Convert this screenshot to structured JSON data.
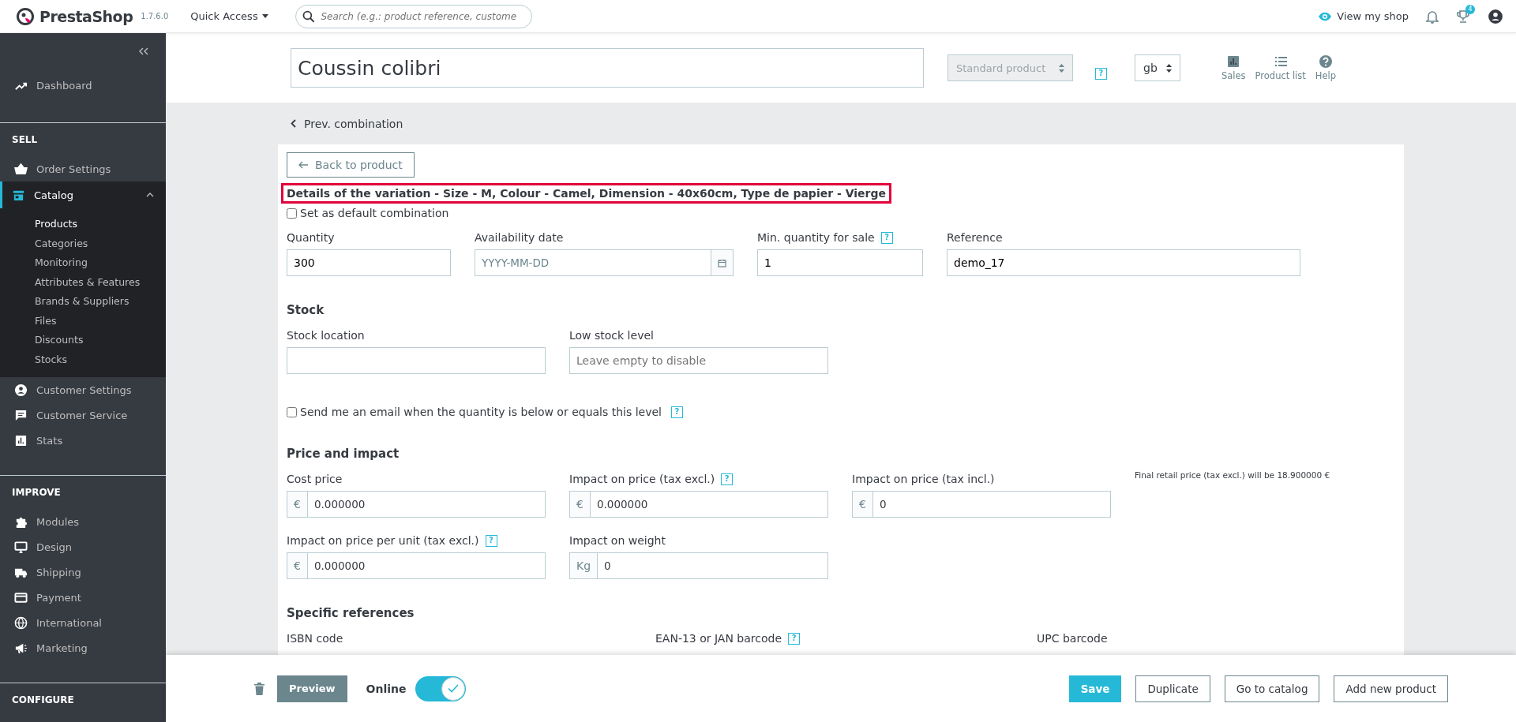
{
  "topbar": {
    "logo": "PrestaShop",
    "version": "1.7.6.0",
    "quick_access": "Quick Access",
    "search": {
      "placeholder": "Search (e.g.: product reference, custome"
    },
    "view_shop": "View my shop",
    "notifications_badge": "4"
  },
  "sidebar": {
    "groups": [
      {
        "items": [
          {
            "label": "Dashboard",
            "kind": "trend",
            "selected": false
          }
        ]
      },
      {
        "heading": "SELL",
        "items": [
          {
            "label": "Order Settings",
            "kind": "basket",
            "selected": false
          },
          {
            "label": "Catalog",
            "kind": "store",
            "selected": true,
            "expanded": true,
            "children": [
              {
                "label": "Products",
                "selected": true
              },
              {
                "label": "Categories",
                "selected": false
              },
              {
                "label": "Monitoring",
                "selected": false
              },
              {
                "label": "Attributes & Features",
                "selected": false
              },
              {
                "label": "Brands & Suppliers",
                "selected": false
              },
              {
                "label": "Files",
                "selected": false
              },
              {
                "label": "Discounts",
                "selected": false
              },
              {
                "label": "Stocks",
                "selected": false
              }
            ]
          },
          {
            "label": "Customer Settings",
            "kind": "person",
            "selected": false
          },
          {
            "label": "Customer Service",
            "kind": "chat",
            "selected": false
          },
          {
            "label": "Stats",
            "kind": "chart",
            "selected": false
          }
        ]
      },
      {
        "heading": "IMPROVE",
        "items": [
          {
            "label": "Modules",
            "kind": "puzzle",
            "selected": false
          },
          {
            "label": "Design",
            "kind": "monitor",
            "selected": false
          },
          {
            "label": "Shipping",
            "kind": "truck",
            "selected": false
          },
          {
            "label": "Payment",
            "kind": "card",
            "selected": false
          },
          {
            "label": "International",
            "kind": "globe",
            "selected": false
          },
          {
            "label": "Marketing",
            "kind": "megaphone",
            "selected": false
          }
        ]
      },
      {
        "heading": "CONFIGURE"
      }
    ]
  },
  "header": {
    "product_name": "Coussin colibri",
    "product_type": {
      "value": "Standard product",
      "disabled": true
    },
    "type_help": "?",
    "language": "gb",
    "actions": [
      {
        "label": "Sales",
        "kind": "chart"
      },
      {
        "label": "Product list",
        "kind": "list"
      },
      {
        "label": "Help",
        "kind": "help"
      }
    ]
  },
  "content": {
    "prev_link": "Prev. combination",
    "back_button": "Back to product",
    "title": {
      "text": "Details of the variation - Size - M, Colour - Camel, Dimension - 40x60cm, Type de papier - Vierge",
      "highlighted": true
    },
    "blocks": [
      {
        "kind": "checkbox",
        "label": "Set as default combination",
        "checked": false
      },
      {
        "kind": "fields",
        "fields": [
          {
            "kind": "text",
            "label": "Quantity",
            "value": "300"
          },
          {
            "kind": "date",
            "label": "Availability date",
            "placeholder": "YYYY-MM-DD"
          },
          {
            "kind": "text",
            "label": "Min. quantity for sale",
            "help": "?",
            "value": "1"
          },
          {
            "kind": "text",
            "label": "Reference",
            "value": "demo_17"
          }
        ]
      },
      {
        "kind": "heading",
        "text": "Stock"
      },
      {
        "kind": "fields",
        "fields": [
          {
            "kind": "text",
            "label": "Stock location"
          },
          {
            "kind": "text",
            "label": "Low stock level",
            "placeholder": "Leave empty to disable"
          }
        ]
      },
      {
        "kind": "checkbox",
        "label": "Send me an email when the quantity is below or equals this level",
        "help": "?",
        "checked": false
      },
      {
        "kind": "heading",
        "text": "Price and impact"
      },
      {
        "kind": "fields",
        "fields": [
          {
            "kind": "prefixed",
            "label": "Cost price",
            "prefix": "€",
            "value": "0.000000"
          },
          {
            "kind": "prefixed",
            "label": "Impact on price (tax excl.)",
            "help": "?",
            "prefix": "€",
            "value": "0.000000"
          },
          {
            "kind": "prefixed",
            "label": "Impact on price (tax incl.)",
            "prefix": "€",
            "value": "0"
          },
          {
            "kind": "note",
            "text": "Final retail price (tax excl.) will be 18.900000 €"
          }
        ]
      },
      {
        "kind": "fields",
        "fields": [
          {
            "kind": "prefixed",
            "label": "Impact on price per unit (tax excl.)",
            "help": "?",
            "prefix": "€",
            "value": "0.000000"
          },
          {
            "kind": "prefixed",
            "label": "Impact on weight",
            "prefix": "Kg",
            "value": "0"
          }
        ]
      },
      {
        "kind": "heading",
        "text": "Specific references"
      },
      {
        "kind": "fields",
        "fields": [
          {
            "kind": "label_only",
            "label": "ISBN code"
          },
          {
            "kind": "label_only",
            "label": "EAN-13 or JAN barcode",
            "help": "?"
          },
          {
            "kind": "label_only",
            "label": "UPC barcode"
          }
        ]
      }
    ]
  },
  "footer": {
    "preview": "Preview",
    "online_label": "Online",
    "online": true,
    "buttons": [
      {
        "label": "Save",
        "primary": true
      },
      {
        "label": "Duplicate",
        "primary": false
      },
      {
        "label": "Go to catalog",
        "primary": false
      },
      {
        "label": "Add new product",
        "primary": false
      }
    ]
  }
}
